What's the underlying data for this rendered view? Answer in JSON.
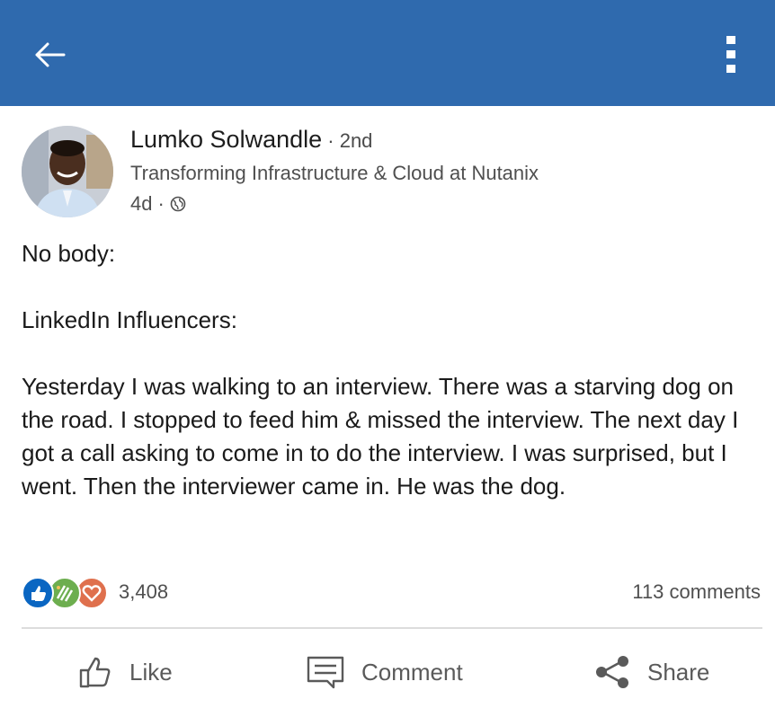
{
  "topbar": {
    "color": "#2f6aae",
    "back_icon": "arrow-left-icon",
    "more_icon": "vertical-dots-icon"
  },
  "post": {
    "author": {
      "name": "Lumko Solwandle",
      "degree": "2nd",
      "headline": "Transforming Infrastructure & Cloud at Nutanix",
      "time": "4d",
      "visibility_icon": "globe-icon"
    },
    "body": [
      "No body:",
      "LinkedIn Influencers:",
      "Yesterday I was walking to an interview. There was a starving dog on the road. I stopped to feed him & missed the interview. The next day I got a call asking to come in to do the interview. I was surprised, but I went. Then the interviewer came in. He was the dog."
    ],
    "reactions": {
      "icons": [
        "like-icon",
        "celebrate-icon",
        "love-icon"
      ],
      "count": "3,408"
    },
    "comments": "113 comments"
  },
  "actions": {
    "like": "Like",
    "comment": "Comment",
    "share": "Share"
  }
}
